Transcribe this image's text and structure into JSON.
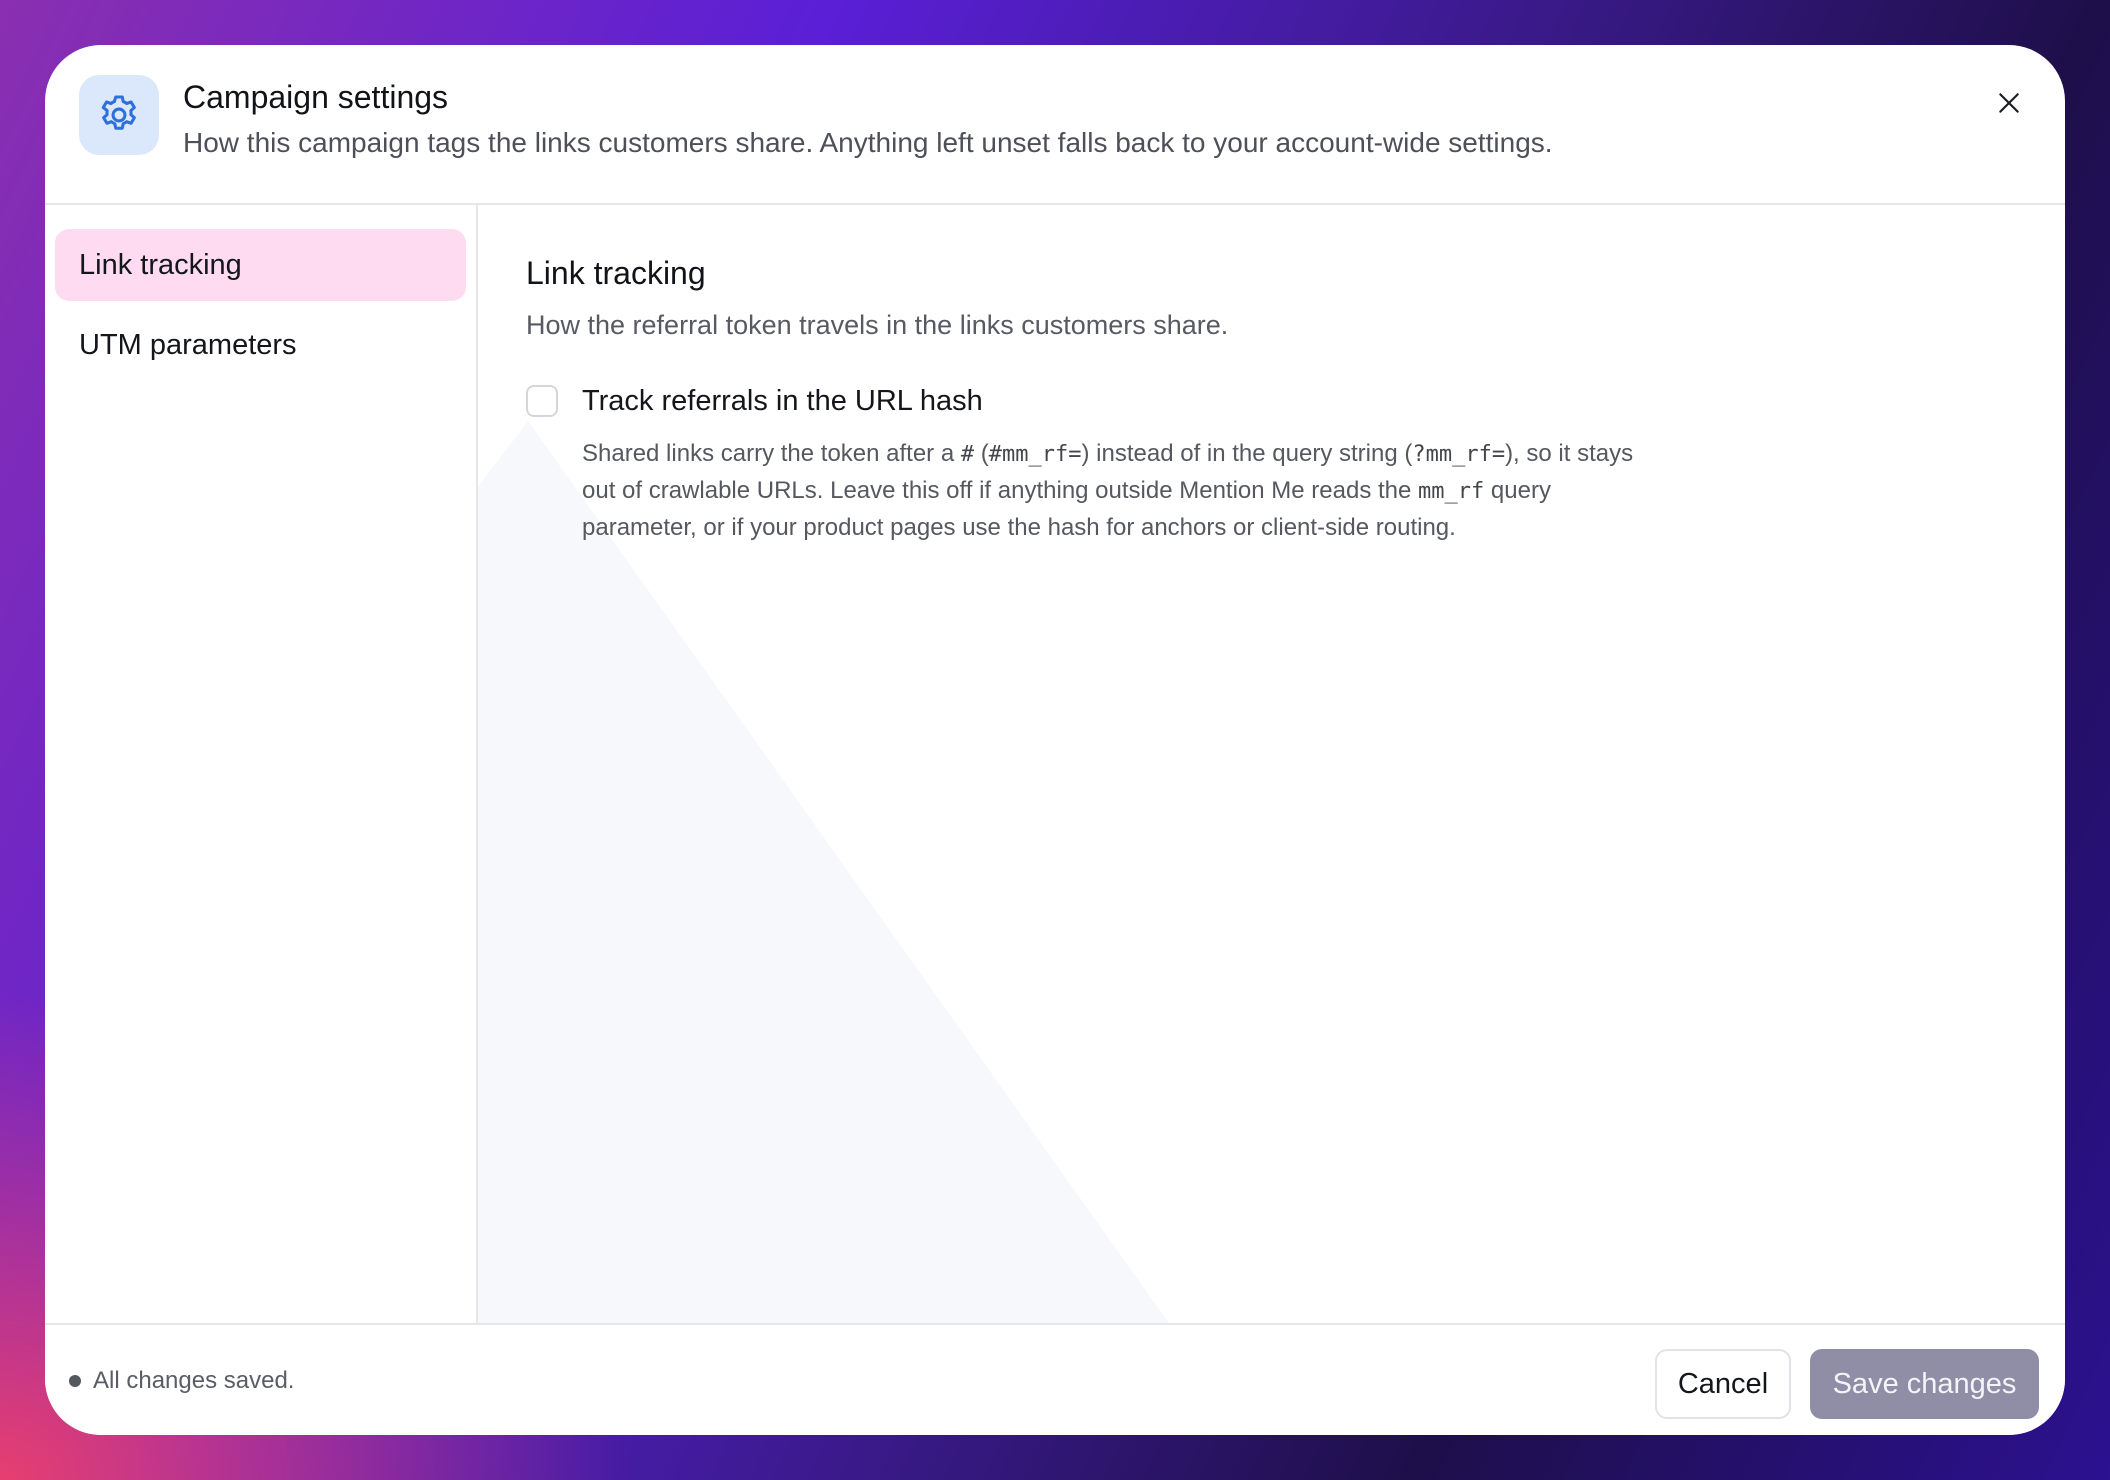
{
  "dialog": {
    "title": "Campaign settings",
    "subtitle": "How this campaign tags the links customers share. Anything left unset falls back to your account-wide settings.",
    "icon": "gear-icon",
    "close_icon": "close-icon"
  },
  "sidebar": {
    "items": [
      {
        "label": "Link tracking",
        "active": true
      },
      {
        "label": "UTM parameters",
        "active": false
      }
    ]
  },
  "section": {
    "title": "Link tracking",
    "subtitle": "How the referral token travels in the links customers share.",
    "option": {
      "label": "Track referrals in the URL hash",
      "checked": false,
      "desc": {
        "p1": "Shared links carry the token after a ",
        "c1": "#",
        "p2": " (",
        "c2": "#mm_rf=",
        "p3": ") instead of in the query string (",
        "c3": "?mm_rf=",
        "p4": "), so it stays out of crawlable URLs. Leave this off if anything outside Mention Me reads the ",
        "c4": "mm_rf",
        "p5": " query parameter, or if your product pages use the hash for anchors or client-side routing."
      }
    }
  },
  "footer": {
    "status": "All changes saved.",
    "cancel_label": "Cancel",
    "save_label": "Save changes"
  },
  "colors": {
    "active_nav_bg": "#fedbf0",
    "icon_tile_bg": "#dbe8fb",
    "icon_color": "#2f6fdc",
    "save_disabled_bg": "#8f8ea6"
  }
}
